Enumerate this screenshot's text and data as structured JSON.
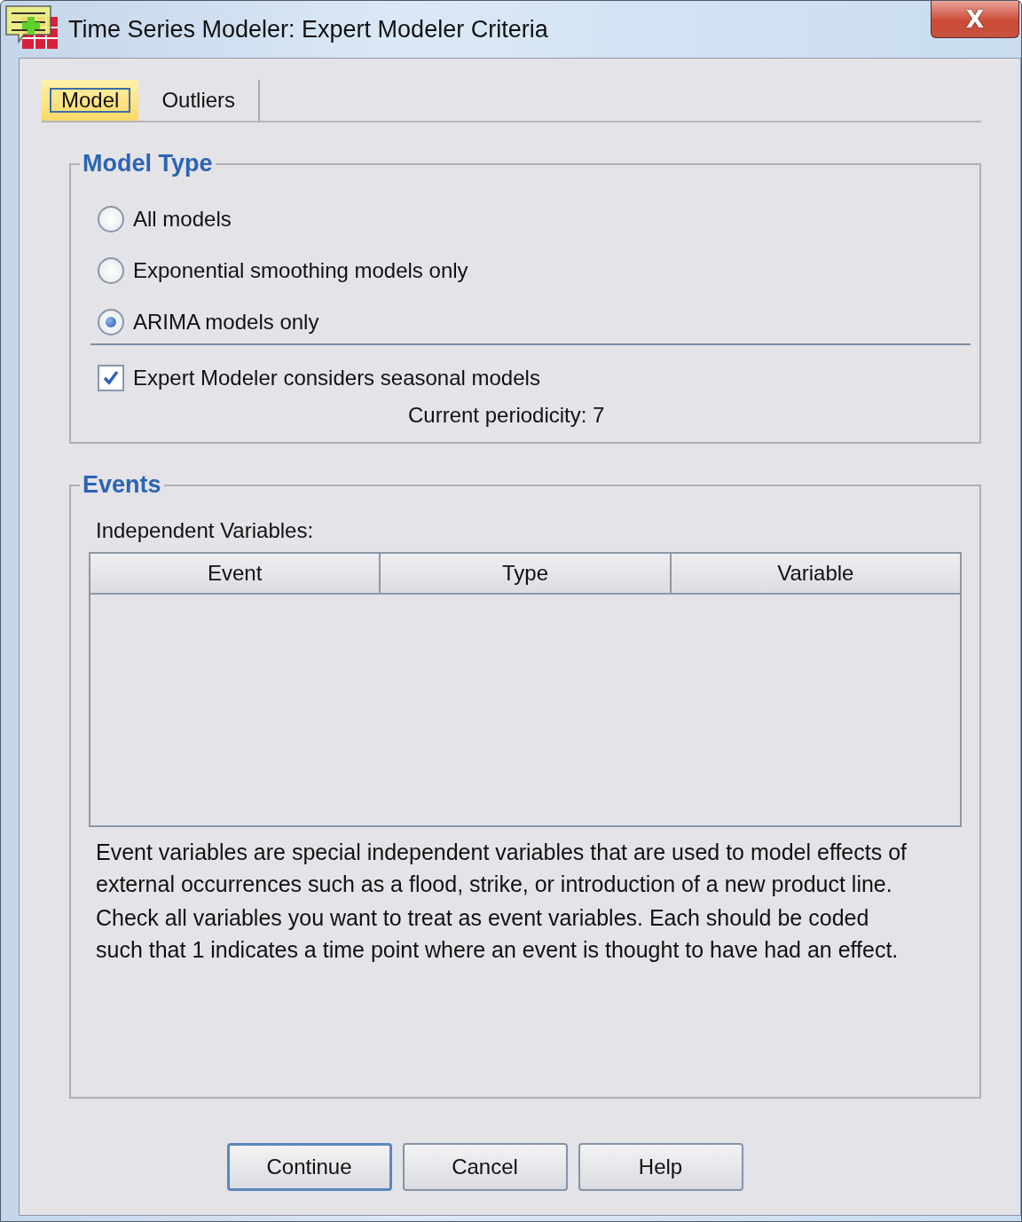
{
  "window": {
    "title": "Time Series Modeler: Expert Modeler Criteria",
    "close": "X"
  },
  "tabs": [
    {
      "label": "Model",
      "selected": true
    },
    {
      "label": "Outliers",
      "selected": false
    }
  ],
  "model_type": {
    "title": "Model Type",
    "options": [
      {
        "label": "All models",
        "selected": false
      },
      {
        "label": "Exponential smoothing models only",
        "selected": false
      },
      {
        "label": "ARIMA models only",
        "selected": true
      }
    ],
    "seasonal": {
      "label": "Expert Modeler considers seasonal models",
      "checked": true
    },
    "periodicity": "Current periodicity: 7"
  },
  "events": {
    "title": "Events",
    "table_label": "Independent Variables:",
    "table": {
      "columns": [
        "Event",
        "Type",
        "Variable"
      ]
    },
    "notes": [
      "Event variables are special independent variables that are used to model effects of external occurrences such as a flood, strike, or introduction of a new product line.",
      "Check all variables you want to treat as event variables. Each should be coded such that 1 indicates a time point where an event is thought to have had an effect."
    ]
  },
  "buttons": [
    {
      "label": "Continue",
      "default": true
    },
    {
      "label": "Cancel",
      "default": false
    },
    {
      "label": "Help",
      "default": false
    }
  ]
}
